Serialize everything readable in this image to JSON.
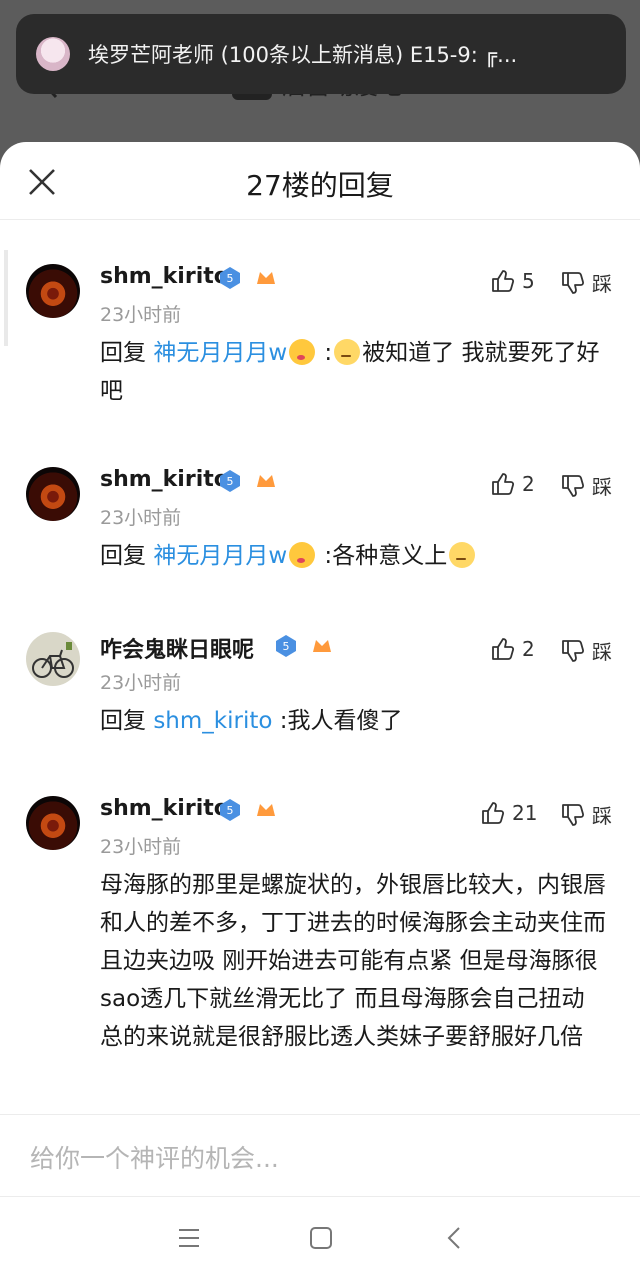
{
  "background": {
    "forum_title": "后宫动漫吧",
    "more_label": "···"
  },
  "notification": {
    "text": "埃罗芒阿老师 (100条以上新消息) E15-9: ╔..."
  },
  "sheet": {
    "title": "27楼的回复"
  },
  "replies": [
    {
      "username": "shm_kirito",
      "level": "5",
      "time": "23小时前",
      "likes": "5",
      "dislike_label": "踩",
      "reply_prefix": "回复",
      "mention": "神无月月月w",
      "text": "被知道了 我就要死了好吧"
    },
    {
      "username": "shm_kirito",
      "level": "5",
      "time": "23小时前",
      "likes": "2",
      "dislike_label": "踩",
      "reply_prefix": "回复",
      "mention": "神无月月月w",
      "text": "各种意义上"
    },
    {
      "username": "咋会鬼眯日眼呢",
      "level": "5",
      "time": "23小时前",
      "likes": "2",
      "dislike_label": "踩",
      "reply_prefix": "回复",
      "mention": "shm_kirito",
      "text": ":我人看傻了"
    },
    {
      "username": "shm_kirito",
      "level": "5",
      "time": "23小时前",
      "likes": "21",
      "dislike_label": "踩",
      "text": "母海豚的那里是螺旋状的，外银唇比较大，内银唇和人的差不多，丁丁进去的时候海豚会主动夹住而且边夹边吸 刚开始进去可能有点紧 但是母海豚很sao透几下就丝滑无比了 而且母海豚会自己扭动 总的来说就是很舒服比透人类妹子要舒服好几倍"
    }
  ],
  "input": {
    "placeholder": "给你一个神评的机会..."
  },
  "colors": {
    "mention": "#2b8fe0",
    "badge_blue": "#4a90e2",
    "badge_orange": "#ff9a3c"
  }
}
